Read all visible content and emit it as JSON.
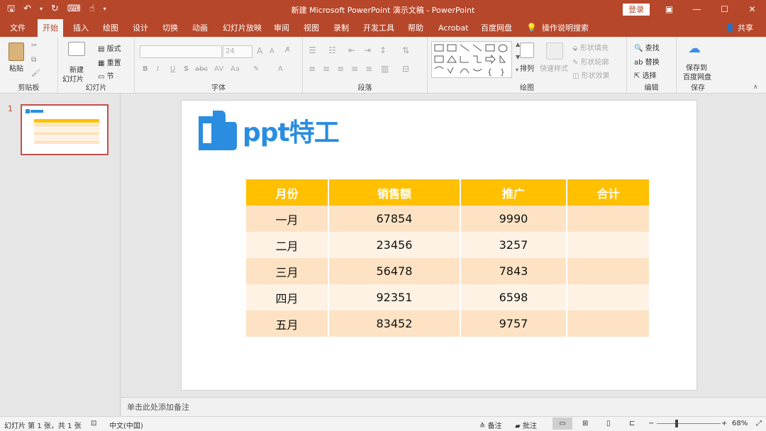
{
  "window": {
    "title": "新建 Microsoft PowerPoint 演示文稿  -  PowerPoint",
    "login": "登录",
    "min": "—",
    "max": "☐",
    "close": "✕",
    "ribbon_display": "▣"
  },
  "qat": {
    "save": "🖫",
    "undo": "↶",
    "undo_arrow": "▾",
    "redo": "↻",
    "present": "⌨",
    "touch": "☝",
    "more": "▾"
  },
  "tabs": [
    "文件",
    "开始",
    "插入",
    "绘图",
    "设计",
    "切换",
    "动画",
    "幻灯片放映",
    "审阅",
    "视图",
    "录制",
    "开发工具",
    "帮助",
    "Acrobat",
    "百度网盘",
    "操作说明搜索"
  ],
  "share": "共享",
  "ribbon": {
    "clipboard": {
      "paste": "粘贴",
      "label": "剪贴板"
    },
    "slides": {
      "new_slide": "新建",
      "new_slide2": "幻灯片",
      "layout": "版式",
      "reset": "重置",
      "section": "节",
      "label": "幻灯片"
    },
    "font": {
      "size": "24",
      "bold": "B",
      "italic": "I",
      "underline": "U",
      "shadow": "S",
      "strike": "abc",
      "spacing": "AV",
      "case": "Aa",
      "color": "A",
      "grow": "A",
      "shrink": "A",
      "label": "字体"
    },
    "paragraph": {
      "label": "段落"
    },
    "drawing": {
      "arrange": "排列",
      "quick_styles": "快速样式",
      "fill": "形状填充",
      "outline": "形状轮廓",
      "effects": "形状效果",
      "label": "绘图"
    },
    "editing": {
      "find": "查找",
      "replace": "替换",
      "select": "选择",
      "label": "编辑"
    },
    "save": {
      "line1": "保存到",
      "line2": "百度网盘",
      "label": "保存"
    }
  },
  "thumbnail": {
    "number": "1"
  },
  "slide": {
    "logo_text": "ppt特工",
    "table": {
      "headers": [
        "月份",
        "销售额",
        "推广",
        "合计"
      ],
      "rows": [
        [
          "一月",
          "67854",
          "9990",
          ""
        ],
        [
          "二月",
          "23456",
          "3257",
          ""
        ],
        [
          "三月",
          "56478",
          "7843",
          ""
        ],
        [
          "四月",
          "92351",
          "6598",
          ""
        ],
        [
          "五月",
          "83452",
          "9757",
          ""
        ]
      ]
    }
  },
  "notes_placeholder": "单击此处添加备注",
  "status": {
    "slide_info": "幻灯片 第 1 张，共 1 张",
    "language": "中文(中国)",
    "notes": "备注",
    "comments": "批注",
    "zoom": "68%",
    "zoom_minus": "−",
    "zoom_plus": "+"
  },
  "colors": {
    "accent": "#b7472a",
    "header": "#ffc000",
    "row_odd": "#fde3c4",
    "row_even": "#fef2e4",
    "logo": "#2a8de0"
  }
}
